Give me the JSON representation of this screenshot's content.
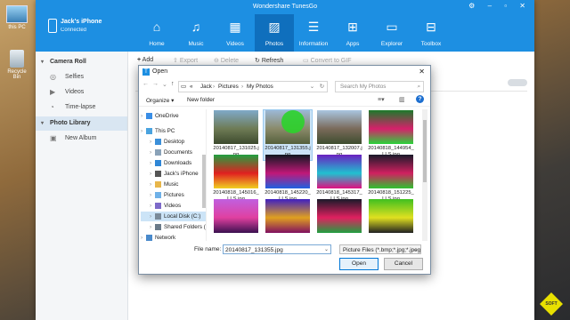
{
  "desktop": {
    "icons": [
      {
        "label": "this PC"
      },
      {
        "label": "Recycle Bin"
      }
    ]
  },
  "app": {
    "title": "Wondershare TunesGo",
    "device": {
      "name": "Jack's iPhone",
      "status": "Connected"
    },
    "nav": [
      {
        "label": "Home",
        "icon": "home-icon",
        "glyph": "⌂"
      },
      {
        "label": "Music",
        "icon": "music-icon",
        "glyph": "♫"
      },
      {
        "label": "Videos",
        "icon": "film-icon",
        "glyph": "▦"
      },
      {
        "label": "Photos",
        "icon": "photo-icon",
        "glyph": "▨"
      },
      {
        "label": "Information",
        "icon": "info-card-icon",
        "glyph": "☰"
      },
      {
        "label": "Apps",
        "icon": "apps-icon",
        "glyph": "⊞"
      },
      {
        "label": "Explorer",
        "icon": "folder-icon",
        "glyph": "▭"
      },
      {
        "label": "Toolbox",
        "icon": "toolbox-icon",
        "glyph": "⊟"
      }
    ],
    "sidebar": {
      "camera_roll": "Camera Roll",
      "camera_items": [
        {
          "label": "Selfies",
          "icon": "camera-icon",
          "glyph": "◎"
        },
        {
          "label": "Videos",
          "icon": "video-icon",
          "glyph": "▶"
        },
        {
          "label": "Time-lapse",
          "icon": "timelapse-icon",
          "glyph": "◔"
        }
      ],
      "photo_library": "Photo Library",
      "library_items": [
        {
          "label": "New Album",
          "icon": "album-icon",
          "glyph": "▣"
        }
      ]
    },
    "toolbar": {
      "add": "Add",
      "export": "Export",
      "delete": "Delete",
      "refresh": "Refresh",
      "convert": "Convert to GIF"
    }
  },
  "dialog": {
    "title": "Open",
    "breadcrumb": [
      "«",
      "Jack",
      "Pictures",
      "My Photos"
    ],
    "search_placeholder": "Search My Photos",
    "organize": "Organize ▾",
    "new_folder": "New folder",
    "help": "?",
    "tree": [
      {
        "label": "OneDrive",
        "icon": "cloud-icon",
        "color": "#3a8ee6",
        "indent": 0
      },
      {
        "label": "This PC",
        "icon": "computer-icon",
        "color": "#4aa3df",
        "indent": 0
      },
      {
        "label": "Desktop",
        "icon": "desktop-folder-icon",
        "color": "#3b8fd9",
        "indent": 1
      },
      {
        "label": "Documents",
        "icon": "documents-folder-icon",
        "color": "#8aa2b8",
        "indent": 1
      },
      {
        "label": "Downloads",
        "icon": "downloads-folder-icon",
        "color": "#2f86d6",
        "indent": 1
      },
      {
        "label": "Jack's iPhone",
        "icon": "phone-icon",
        "color": "#555555",
        "indent": 1
      },
      {
        "label": "Music",
        "icon": "music-folder-icon",
        "color": "#e8b64a",
        "indent": 1
      },
      {
        "label": "Pictures",
        "icon": "pictures-folder-icon",
        "color": "#6fb1e8",
        "indent": 1
      },
      {
        "label": "Videos",
        "icon": "videos-folder-icon",
        "color": "#7d6ac9",
        "indent": 1
      },
      {
        "label": "Local Disk (C:)",
        "icon": "disk-icon",
        "color": "#7a8a99",
        "indent": 1,
        "selected": true
      },
      {
        "label": "Shared Folders (\\",
        "icon": "network-drive-icon",
        "color": "#6a7a89",
        "indent": 1
      },
      {
        "label": "Network",
        "icon": "network-icon",
        "color": "#4a8acb",
        "indent": 0
      }
    ],
    "files": [
      {
        "name": "20140817_131025.jpg",
        "colors": [
          "#7fa9c9",
          "#6e7b55",
          "#3d4a2e"
        ]
      },
      {
        "name": "20140817_131355.jpg",
        "colors": [
          "#9cb8d6",
          "#8a8a6a",
          "#55603c"
        ],
        "selected": true
      },
      {
        "name": "20140817_132007.jpg",
        "colors": [
          "#a9c6e0",
          "#7a6a5a",
          "#3e4d2f"
        ]
      },
      {
        "name": "20140818_144954_LLS.jpg",
        "colors": [
          "#1a7a2a",
          "#d6206b",
          "#2ad43a"
        ]
      },
      {
        "name": "20140818_145016_LLS.jpg",
        "colors": [
          "#20a040",
          "#e02020",
          "#f0d020"
        ]
      },
      {
        "name": "20140818_145220_LLS.jpg",
        "colors": [
          "#101820",
          "#c01878",
          "#2060e0"
        ]
      },
      {
        "name": "20140818_145317_LLS.jpg",
        "colors": [
          "#6a20c0",
          "#20c0d0",
          "#e01080"
        ]
      },
      {
        "name": "20140818_151225_LLS.jpg",
        "colors": [
          "#1a1a2a",
          "#d02060",
          "#30c030"
        ]
      },
      {
        "name": "",
        "colors": [
          "#c060e0",
          "#e040a0",
          "#3a1050"
        ]
      },
      {
        "name": "",
        "colors": [
          "#4020c0",
          "#e0a020",
          "#801060"
        ]
      },
      {
        "name": "",
        "colors": [
          "#1a1a2a",
          "#e02060",
          "#20a040"
        ]
      },
      {
        "name": "",
        "colors": [
          "#40c020",
          "#e0e020",
          "#202020"
        ]
      }
    ],
    "filename_label": "File name:",
    "filename_value": "20140817_131355.jpg",
    "filetype_value": "Picture Files (*.bmp;*.jpg;*.jpeg",
    "open": "Open",
    "cancel": "Cancel"
  },
  "watermark": "SOFT",
  "colors": {
    "accent": "#1d8fe2",
    "nav_active": "#0f6fbd",
    "selection": "#cce4f7"
  }
}
